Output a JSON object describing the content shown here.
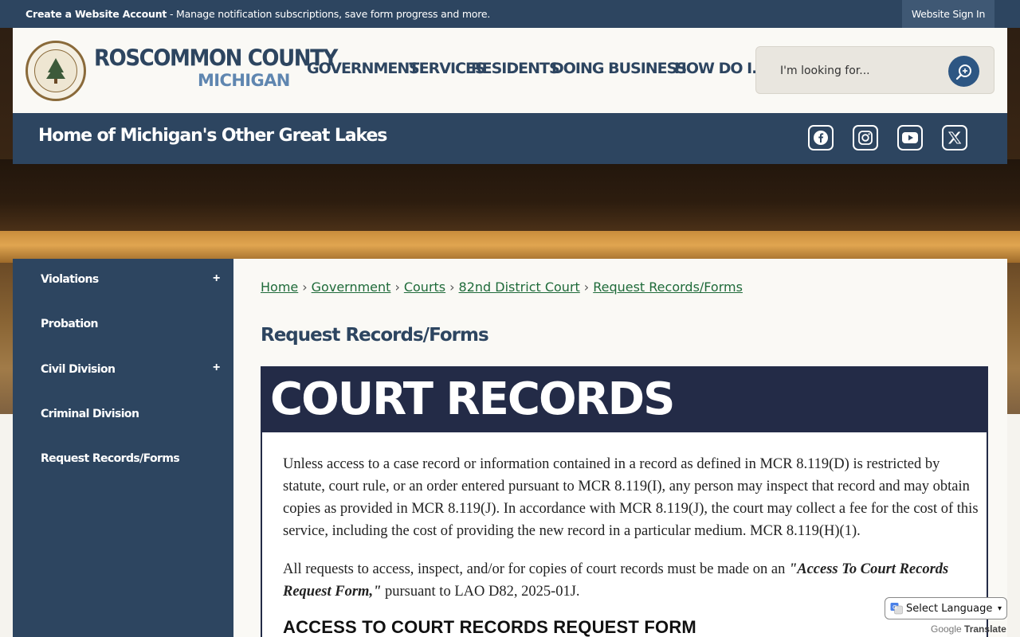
{
  "topbar": {
    "create_account": "Create a Website Account",
    "message": " - Manage notification subscriptions, save form progress and more.",
    "signin": "Website Sign In"
  },
  "header": {
    "county": "ROSCOMMON COUNTY",
    "state": "MICHIGAN",
    "nav": [
      "GOVERNMENT",
      "SERVICES",
      "RESIDENTS",
      "DOING BUSINESS",
      "HOW DO I..."
    ],
    "search_placeholder": "I'm looking for..."
  },
  "tagbar": {
    "tagline": "Home of Michigan's Other Great Lakes",
    "social": [
      "facebook-icon",
      "instagram-icon",
      "youtube-icon",
      "x-icon"
    ]
  },
  "sidebar": {
    "items": [
      {
        "label": "Violations",
        "expandable": true
      },
      {
        "label": "Probation",
        "expandable": false
      },
      {
        "label": "Civil Division",
        "expandable": true
      },
      {
        "label": "Criminal Division",
        "expandable": false
      },
      {
        "label": "Request Records/Forms",
        "expandable": false
      }
    ]
  },
  "breadcrumb": [
    "Home",
    "Government",
    "Courts",
    "82nd District Court",
    "Request Records/Forms"
  ],
  "content": {
    "title": "Request Records/Forms",
    "banner": "COURT RECORDS",
    "para1": "Unless access to a case record or information contained in a record as defined in MCR 8.119(D) is restricted by statute, court rule, or an order entered pursuant to MCR 8.119(I), any person may inspect that record and may obtain copies as provided in MCR 8.119(J). In accordance with MCR 8.119(J), the court may collect a fee for the cost of this service, including the cost of providing the new record in a particular medium. MCR 8.119(H)(1).",
    "para2_start": "All requests to access, inspect, and/or for copies of court records must be made on an ",
    "para2_form": "\"Access To Court Records Request Form,\"",
    "para2_end": " pursuant to LAO D82, 2025-01J.",
    "form_heading": "ACCESS TO COURT RECORDS REQUEST FORM"
  },
  "translate": {
    "select_label": "Select Language",
    "powered_by": "Google",
    "translate_word": "Translate"
  },
  "colors": {
    "navy": "#2d4560",
    "banner": "#232b47",
    "link_green": "#1f6b3a",
    "accent_blue": "#5f86b0"
  }
}
